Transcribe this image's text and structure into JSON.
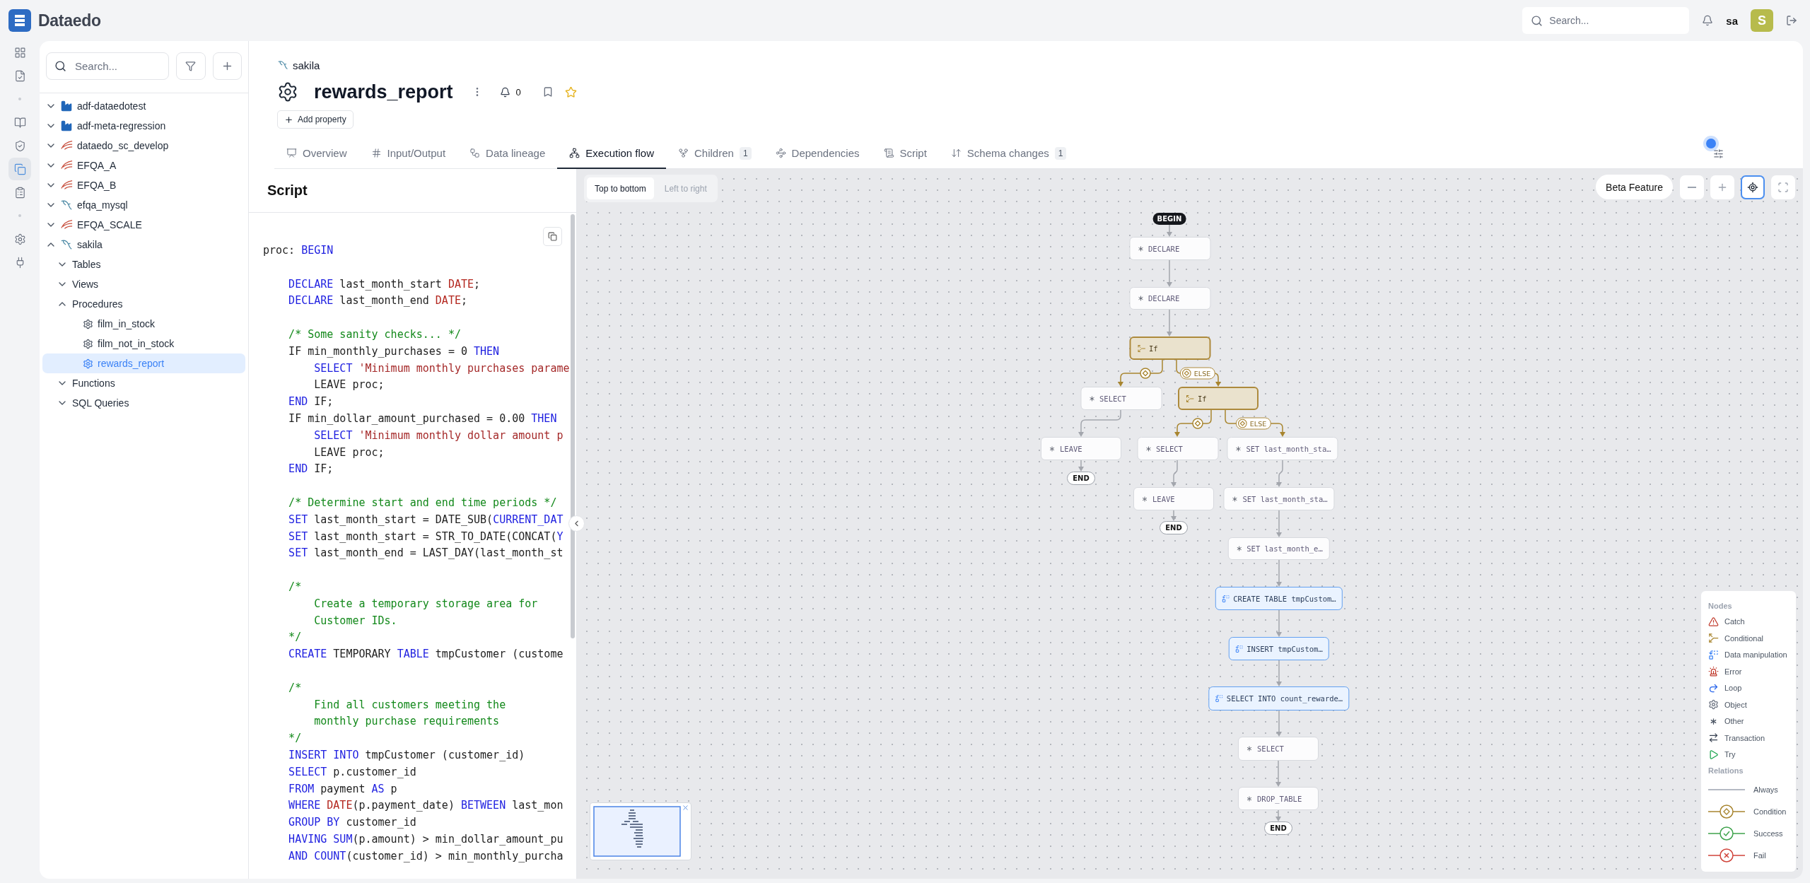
{
  "app": {
    "name": "Dataedo"
  },
  "topbar": {
    "search": {
      "placeholder": "Search..."
    },
    "user": {
      "name": "sa",
      "initial": "S"
    }
  },
  "rail": {
    "groups": [
      {
        "items": [
          {
            "kind": "grid",
            "selected": false
          },
          {
            "kind": "checklist",
            "selected": false
          }
        ]
      },
      {
        "items": [
          {
            "kind": "book",
            "selected": false
          },
          {
            "kind": "shield",
            "selected": false
          },
          {
            "kind": "copy",
            "selected": true
          },
          {
            "kind": "clipboard",
            "selected": false
          }
        ]
      },
      {
        "items": [
          {
            "kind": "object",
            "selected": false
          },
          {
            "kind": "plug",
            "selected": false
          }
        ]
      }
    ]
  },
  "sidebar": {
    "search": {
      "placeholder": "Search..."
    },
    "tree": [
      {
        "label": "adf-dataedotest",
        "kind": "factory",
        "expanded": false,
        "selected": false
      },
      {
        "label": "adf-meta-regression",
        "kind": "factory",
        "expanded": false,
        "selected": false
      },
      {
        "label": "dataedo_sc_develop",
        "kind": "swoosh",
        "expanded": false,
        "selected": false
      },
      {
        "label": "EFQA_A",
        "kind": "swoosh",
        "expanded": false,
        "selected": false
      },
      {
        "label": "EFQA_B",
        "kind": "swoosh",
        "expanded": false,
        "selected": false
      },
      {
        "label": "efqa_mysql",
        "kind": "dolphin",
        "expanded": false,
        "selected": false
      },
      {
        "label": "EFQA_SCALE",
        "kind": "swoosh",
        "expanded": false,
        "selected": false
      },
      {
        "label": "sakila",
        "kind": "dolphin",
        "expanded": true,
        "selected": false,
        "children": [
          {
            "label": "Tables",
            "expanded": false,
            "selected": false
          },
          {
            "label": "Views",
            "expanded": false,
            "selected": false
          },
          {
            "label": "Procedures",
            "expanded": true,
            "selected": false,
            "children": [
              {
                "label": "film_in_stock",
                "kind": "gear",
                "selected": false
              },
              {
                "label": "film_not_in_stock",
                "kind": "gear",
                "selected": false
              },
              {
                "label": "rewards_report",
                "kind": "gear",
                "selected": true
              }
            ]
          },
          {
            "label": "Functions",
            "expanded": false,
            "selected": false
          },
          {
            "label": "SQL Queries",
            "expanded": false,
            "selected": false
          }
        ]
      }
    ]
  },
  "object": {
    "breadcrumb": "sakila",
    "title": "rewards_report",
    "notifications": "0",
    "add_property": "Add property"
  },
  "tabs": [
    {
      "label": "Overview",
      "kind": "overview",
      "selected": false
    },
    {
      "label": "Input/Output",
      "kind": "io",
      "selected": false
    },
    {
      "label": "Data lineage",
      "kind": "lineage",
      "selected": false
    },
    {
      "label": "Execution flow",
      "kind": "flow",
      "selected": true
    },
    {
      "label": "Children",
      "kind": "children",
      "badge": "1",
      "selected": false
    },
    {
      "label": "Dependencies",
      "kind": "dependencies",
      "selected": false
    },
    {
      "label": "Script",
      "kind": "script",
      "selected": false
    },
    {
      "label": "Schema changes",
      "kind": "schema",
      "badge": "1",
      "selected": false
    }
  ],
  "script": {
    "title": "Script",
    "lines": [
      {
        "kind": "code",
        "tokens": [
          {
            "text": "proc:",
            "kind": "plain"
          },
          {
            "text": " BEGIN",
            "kind": "keyword"
          }
        ]
      },
      {
        "kind": "blank"
      },
      {
        "kind": "code",
        "tokens": [
          {
            "text": "    DECLARE",
            "kind": "keyword"
          },
          {
            "text": " last_month_start ",
            "kind": "plain"
          },
          {
            "text": "DATE",
            "kind": "builtin"
          },
          {
            "text": ";",
            "kind": "plain"
          }
        ]
      },
      {
        "kind": "code",
        "tokens": [
          {
            "text": "    DECLARE",
            "kind": "keyword"
          },
          {
            "text": " last_month_end ",
            "kind": "plain"
          },
          {
            "text": "DATE",
            "kind": "builtin"
          },
          {
            "text": ";",
            "kind": "plain"
          }
        ]
      },
      {
        "kind": "blank"
      },
      {
        "kind": "code",
        "tokens": [
          {
            "text": "    /* Some sanity checks... */",
            "kind": "comment"
          }
        ]
      },
      {
        "kind": "code",
        "tokens": [
          {
            "text": "    IF min_monthly_purchases = 0 ",
            "kind": "plain"
          },
          {
            "text": "THEN",
            "kind": "keyword"
          }
        ]
      },
      {
        "kind": "code",
        "tokens": [
          {
            "text": "        SELECT",
            "kind": "keyword"
          },
          {
            "text": " 'Minimum monthly purchases parame",
            "kind": "string"
          }
        ]
      },
      {
        "kind": "code",
        "tokens": [
          {
            "text": "        LEAVE proc;",
            "kind": "plain"
          }
        ]
      },
      {
        "kind": "code",
        "tokens": [
          {
            "text": "    END",
            "kind": "keyword"
          },
          {
            "text": " IF;",
            "kind": "plain"
          }
        ]
      },
      {
        "kind": "code",
        "tokens": [
          {
            "text": "    IF min_dollar_amount_purchased = 0.00 ",
            "kind": "plain"
          },
          {
            "text": "THEN",
            "kind": "keyword"
          }
        ]
      },
      {
        "kind": "code",
        "tokens": [
          {
            "text": "        SELECT",
            "kind": "keyword"
          },
          {
            "text": " 'Minimum monthly dollar amount p",
            "kind": "string"
          }
        ]
      },
      {
        "kind": "code",
        "tokens": [
          {
            "text": "        LEAVE proc;",
            "kind": "plain"
          }
        ]
      },
      {
        "kind": "code",
        "tokens": [
          {
            "text": "    END",
            "kind": "keyword"
          },
          {
            "text": " IF;",
            "kind": "plain"
          }
        ]
      },
      {
        "kind": "blank"
      },
      {
        "kind": "code",
        "tokens": [
          {
            "text": "    /* Determine start and end time periods */",
            "kind": "comment"
          }
        ]
      },
      {
        "kind": "code",
        "tokens": [
          {
            "text": "    SET",
            "kind": "keyword"
          },
          {
            "text": " last_month_start = DATE_SUB(",
            "kind": "plain"
          },
          {
            "text": "CURRENT_DAT",
            "kind": "keyword"
          }
        ]
      },
      {
        "kind": "code",
        "tokens": [
          {
            "text": "    SET",
            "kind": "keyword"
          },
          {
            "text": " last_month_start = STR_TO_DATE(CONCAT(",
            "kind": "plain"
          },
          {
            "text": "Y",
            "kind": "keyword"
          }
        ]
      },
      {
        "kind": "code",
        "tokens": [
          {
            "text": "    SET",
            "kind": "keyword"
          },
          {
            "text": " last_month_end = LAST_DAY(last_month_st",
            "kind": "plain"
          }
        ]
      },
      {
        "kind": "blank"
      },
      {
        "kind": "code",
        "tokens": [
          {
            "text": "    /*",
            "kind": "comment"
          }
        ]
      },
      {
        "kind": "code",
        "tokens": [
          {
            "text": "        Create a temporary storage area for",
            "kind": "comment"
          }
        ]
      },
      {
        "kind": "code",
        "tokens": [
          {
            "text": "        Customer IDs.",
            "kind": "comment"
          }
        ]
      },
      {
        "kind": "code",
        "tokens": [
          {
            "text": "    */",
            "kind": "comment"
          }
        ]
      },
      {
        "kind": "code",
        "tokens": [
          {
            "text": "    CREATE",
            "kind": "keyword"
          },
          {
            "text": " TEMPORARY ",
            "kind": "plain"
          },
          {
            "text": "TABLE",
            "kind": "keyword"
          },
          {
            "text": " tmpCustomer (custome",
            "kind": "plain"
          }
        ]
      },
      {
        "kind": "blank"
      },
      {
        "kind": "code",
        "tokens": [
          {
            "text": "    /*",
            "kind": "comment"
          }
        ]
      },
      {
        "kind": "code",
        "tokens": [
          {
            "text": "        Find all customers meeting the",
            "kind": "comment"
          }
        ]
      },
      {
        "kind": "code",
        "tokens": [
          {
            "text": "        monthly purchase requirements",
            "kind": "comment"
          }
        ]
      },
      {
        "kind": "code",
        "tokens": [
          {
            "text": "    */",
            "kind": "comment"
          }
        ]
      },
      {
        "kind": "code",
        "tokens": [
          {
            "text": "    INSERT",
            "kind": "keyword"
          },
          {
            "text": " INTO",
            "kind": "keyword"
          },
          {
            "text": " tmpCustomer (customer_id)",
            "kind": "plain"
          }
        ]
      },
      {
        "kind": "code",
        "tokens": [
          {
            "text": "    SELECT",
            "kind": "keyword"
          },
          {
            "text": " p.customer_id",
            "kind": "plain"
          }
        ]
      },
      {
        "kind": "code",
        "tokens": [
          {
            "text": "    FROM",
            "kind": "keyword"
          },
          {
            "text": " payment ",
            "kind": "plain"
          },
          {
            "text": "AS",
            "kind": "keyword"
          },
          {
            "text": " p",
            "kind": "plain"
          }
        ]
      },
      {
        "kind": "code",
        "tokens": [
          {
            "text": "    WHERE",
            "kind": "keyword"
          },
          {
            "text": " DATE",
            "kind": "builtin"
          },
          {
            "text": "(p.payment_date) ",
            "kind": "plain"
          },
          {
            "text": "BETWEEN",
            "kind": "keyword"
          },
          {
            "text": " last_mon",
            "kind": "plain"
          }
        ]
      },
      {
        "kind": "code",
        "tokens": [
          {
            "text": "    GROUP BY",
            "kind": "keyword"
          },
          {
            "text": " customer_id",
            "kind": "plain"
          }
        ]
      },
      {
        "kind": "code",
        "tokens": [
          {
            "text": "    HAVING",
            "kind": "keyword"
          },
          {
            "text": " SUM",
            "kind": "keyword"
          },
          {
            "text": "(p.amount) > min_dollar_amount_pu",
            "kind": "plain"
          }
        ]
      },
      {
        "kind": "code",
        "tokens": [
          {
            "text": "    AND",
            "kind": "keyword"
          },
          {
            "text": " COUNT",
            "kind": "keyword"
          },
          {
            "text": "(customer_id) > min_monthly_purcha",
            "kind": "plain"
          }
        ]
      }
    ]
  },
  "flow": {
    "direction": [
      {
        "label": "Top to bottom",
        "selected": true
      },
      {
        "label": "Left to right",
        "selected": false
      }
    ],
    "beta": "Beta Feature",
    "tools": [
      {
        "kind": "zoom-out",
        "selected": false
      },
      {
        "kind": "zoom-in",
        "selected": false
      },
      {
        "kind": "center",
        "selected": true
      },
      {
        "kind": "fullscreen",
        "selected": false
      }
    ],
    "nodes": [
      {
        "kind": "start",
        "label": "BEGIN"
      },
      {
        "kind": "other",
        "label": "DECLARE"
      },
      {
        "kind": "other",
        "label": "DECLARE"
      },
      {
        "kind": "conditional",
        "label": "If"
      },
      {
        "kind": "other",
        "label": "SELECT"
      },
      {
        "kind": "conditional",
        "label": "If"
      },
      {
        "kind": "other",
        "label": "LEAVE"
      },
      {
        "kind": "end",
        "label": "END"
      },
      {
        "kind": "other",
        "label": "SELECT"
      },
      {
        "kind": "other",
        "label": "SET last_month_sta…"
      },
      {
        "kind": "other",
        "label": "LEAVE"
      },
      {
        "kind": "end",
        "label": "END"
      },
      {
        "kind": "other",
        "label": "SET last_month_sta…"
      },
      {
        "kind": "other",
        "label": "SET last_month_e…"
      },
      {
        "kind": "data",
        "label": "CREATE TABLE tmpCustom…"
      },
      {
        "kind": "data",
        "label": "INSERT tmpCustom…"
      },
      {
        "kind": "data",
        "label": "SELECT INTO count_rewarde…"
      },
      {
        "kind": "other",
        "label": "SELECT"
      },
      {
        "kind": "other",
        "label": "DROP_TABLE"
      },
      {
        "kind": "end",
        "label": "END"
      }
    ],
    "edges": [
      {
        "kind": "always"
      },
      {
        "kind": "always"
      },
      {
        "kind": "always"
      },
      {
        "kind": "condition"
      },
      {
        "kind": "condition",
        "label": "ELSE"
      },
      {
        "kind": "always"
      },
      {
        "kind": "always"
      },
      {
        "kind": "condition"
      },
      {
        "kind": "condition",
        "label": "ELSE"
      },
      {
        "kind": "always"
      },
      {
        "kind": "always"
      },
      {
        "kind": "always"
      },
      {
        "kind": "always"
      },
      {
        "kind": "always"
      },
      {
        "kind": "always"
      },
      {
        "kind": "always"
      },
      {
        "kind": "always"
      },
      {
        "kind": "always"
      },
      {
        "kind": "always"
      }
    ],
    "legend": {
      "nodes_title": "Nodes",
      "nodes": [
        {
          "kind": "catch",
          "label": "Catch"
        },
        {
          "kind": "conditional",
          "label": "Conditional"
        },
        {
          "kind": "data",
          "label": "Data manipulation"
        },
        {
          "kind": "error",
          "label": "Error"
        },
        {
          "kind": "loop",
          "label": "Loop"
        },
        {
          "kind": "object",
          "label": "Object"
        },
        {
          "kind": "other",
          "label": "Other"
        },
        {
          "kind": "transaction",
          "label": "Transaction"
        },
        {
          "kind": "try",
          "label": "Try"
        }
      ],
      "relations_title": "Relations",
      "relations": [
        {
          "kind": "always",
          "label": "Always"
        },
        {
          "kind": "condition",
          "label": "Condition"
        },
        {
          "kind": "success",
          "label": "Success"
        },
        {
          "kind": "fail",
          "label": "Fail"
        }
      ]
    }
  }
}
